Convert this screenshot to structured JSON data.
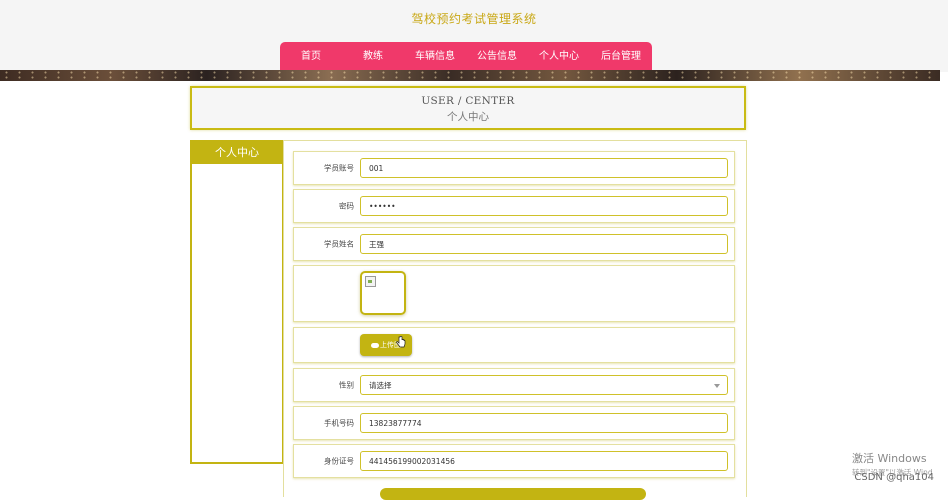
{
  "header": {
    "site_title": "驾校预约考试管理系统"
  },
  "nav": {
    "items": [
      "首页",
      "教练",
      "车辆信息",
      "公告信息",
      "个人中心",
      "后台管理"
    ]
  },
  "page_header": {
    "en": "USER / CENTER",
    "zh": "个人中心"
  },
  "sidebar": {
    "title": "个人中心"
  },
  "form": {
    "account_label": "学员账号",
    "account_value": "001",
    "password_label": "密码",
    "password_value": "••••••",
    "name_label": "学员姓名",
    "name_value": "王强",
    "upload_label": "上传图",
    "gender_label": "性别",
    "gender_value": "请选择",
    "phone_label": "手机号码",
    "phone_value": "13823877774",
    "id_label": "身份证号",
    "id_value": "441456199002031456"
  },
  "overlay": {
    "watermark_title": "激活 Windows",
    "watermark_sub": "转到\"设置\"以激活 Wind",
    "csdn": "CSDN @qha104"
  },
  "colors": {
    "accent": "#c3b412",
    "nav": "#f0396a",
    "title": "#c9a816"
  }
}
